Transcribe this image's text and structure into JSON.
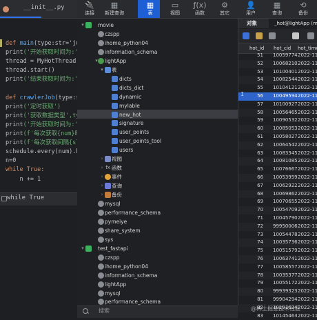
{
  "ide": {
    "tab_label": "__init__.py",
    "breadcrumb": "while True",
    "code_lines": [
      {
        "parts": [
          [
            "def ",
            "#cf8e6d"
          ],
          [
            "main",
            "#56a8f5"
          ],
          [
            "(type:str='juejin'",
            "#bcbec4"
          ]
        ]
      },
      {
        "parts": [
          [
            "print",
            "#bcbec4"
          ],
          [
            "('开始获取时间为:',",
            "#6aab73"
          ]
        ]
      },
      {
        "parts": [
          [
            "thread = MyHotThread(t",
            "#bcbec4"
          ]
        ]
      },
      {
        "parts": [
          [
            "thread.start()",
            "#bcbec4"
          ]
        ]
      },
      {
        "parts": [
          [
            "print",
            "#bcbec4"
          ],
          [
            "('结束获取时间为:',",
            "#6aab73"
          ]
        ]
      },
      {
        "parts": [
          [
            "",
            "#bcbec4"
          ]
        ]
      },
      {
        "parts": [
          [
            "def ",
            "#cf8e6d"
          ],
          [
            "crawlerJob",
            "#56a8f5"
          ],
          [
            "(type:str='j",
            "#bcbec4"
          ]
        ]
      },
      {
        "parts": [
          [
            "print",
            "#bcbec4"
          ],
          [
            "('定时获取')",
            "#6aab73"
          ]
        ]
      },
      {
        "parts": [
          [
            "print",
            "#bcbec4"
          ],
          [
            "('获取数据类型',typ",
            "#6aab73"
          ]
        ]
      },
      {
        "parts": [
          [
            "print",
            "#bcbec4"
          ],
          [
            "('开始获取时间为:',",
            "#6aab73"
          ]
        ]
      },
      {
        "parts": [
          [
            "print",
            "#bcbec4"
          ],
          [
            "(f'每次获取{num}时间",
            "#6aab73"
          ]
        ]
      },
      {
        "parts": [
          [
            "print",
            "#bcbec4"
          ],
          [
            "(f'每次获取间隔{sl}",
            "#6aab73"
          ]
        ]
      },
      {
        "parts": [
          [
            "schedule.every(num).ho",
            "#bcbec4"
          ]
        ]
      },
      {
        "parts": [
          [
            "n=0",
            "#bcbec4"
          ]
        ]
      },
      {
        "parts": [
          [
            "while ",
            "#cf8e6d"
          ],
          [
            "True:",
            "#cf8e6d"
          ]
        ]
      },
      {
        "parts": [
          [
            "    n += 1",
            "#bcbec4"
          ]
        ]
      }
    ]
  },
  "toolbar": {
    "items": [
      {
        "label": "连接",
        "icon": "🔌"
      },
      {
        "label": "新建查询",
        "icon": "▦"
      },
      {
        "label": "表",
        "icon": "▦"
      },
      {
        "label": "视图",
        "icon": "▭"
      },
      {
        "label": "函数",
        "icon": "ƒ(x)"
      },
      {
        "label": "其它",
        "icon": "⚙"
      },
      {
        "label": "用户",
        "icon": "👤"
      },
      {
        "label": "查询",
        "icon": "▦"
      },
      {
        "label": "备份",
        "icon": "⟲"
      }
    ]
  },
  "tree": {
    "items": [
      {
        "text": "movie",
        "indent": 0,
        "arrow": "▾",
        "icon": "conn"
      },
      {
        "text": "czspp",
        "indent": 1,
        "arrow": "",
        "icon": "db"
      },
      {
        "text": "ihome_python04",
        "indent": 1,
        "arrow": "",
        "icon": "db"
      },
      {
        "text": "information_schema",
        "indent": 1,
        "arrow": "",
        "icon": "db"
      },
      {
        "text": "lightApp",
        "indent": 1,
        "arrow": "▾",
        "icon": "db-open"
      },
      {
        "text": "表",
        "indent": 2,
        "arrow": "▾",
        "icon": "group"
      },
      {
        "text": "dicts",
        "indent": 3,
        "arrow": "",
        "icon": "tbl"
      },
      {
        "text": "dicts_dict",
        "indent": 3,
        "arrow": "",
        "icon": "tbl"
      },
      {
        "text": "dynamic",
        "indent": 3,
        "arrow": "",
        "icon": "tbl"
      },
      {
        "text": "mylable",
        "indent": 3,
        "arrow": "",
        "icon": "tbl"
      },
      {
        "text": "new_hot",
        "indent": 3,
        "arrow": "",
        "icon": "tbl"
      },
      {
        "text": "signature",
        "indent": 3,
        "arrow": "",
        "icon": "tbl"
      },
      {
        "text": "user_points",
        "indent": 3,
        "arrow": "",
        "icon": "tbl"
      },
      {
        "text": "user_points_tool",
        "indent": 3,
        "arrow": "",
        "icon": "tbl"
      },
      {
        "text": "users",
        "indent": 3,
        "arrow": "",
        "icon": "tbl"
      },
      {
        "text": "视图",
        "indent": 2,
        "arrow": "›",
        "icon": "view"
      },
      {
        "text": "函数",
        "indent": 2,
        "arrow": "›",
        "icon": "func"
      },
      {
        "text": "事件",
        "indent": 2,
        "arrow": "›",
        "icon": "event"
      },
      {
        "text": "查询",
        "indent": 2,
        "arrow": "›",
        "icon": "query"
      },
      {
        "text": "备份",
        "indent": 2,
        "arrow": "›",
        "icon": "backup"
      },
      {
        "text": "mysql",
        "indent": 1,
        "arrow": "",
        "icon": "db"
      },
      {
        "text": "performance_schema",
        "indent": 1,
        "arrow": "",
        "icon": "db"
      },
      {
        "text": "pymeiye",
        "indent": 1,
        "arrow": "",
        "icon": "db"
      },
      {
        "text": "share_system",
        "indent": 1,
        "arrow": "",
        "icon": "db"
      },
      {
        "text": "sys",
        "indent": 1,
        "arrow": "",
        "icon": "db"
      },
      {
        "text": "test_fastapi",
        "indent": 0,
        "arrow": "▾",
        "icon": "conn"
      },
      {
        "text": "czspp",
        "indent": 1,
        "arrow": "",
        "icon": "db"
      },
      {
        "text": "ihome_python04",
        "indent": 1,
        "arrow": "",
        "icon": "db"
      },
      {
        "text": "information_schema",
        "indent": 1,
        "arrow": "",
        "icon": "db"
      },
      {
        "text": "lightApp",
        "indent": 1,
        "arrow": "",
        "icon": "db"
      },
      {
        "text": "mysql",
        "indent": 1,
        "arrow": "",
        "icon": "db"
      },
      {
        "text": "performance_schema",
        "indent": 1,
        "arrow": "",
        "icon": "db"
      }
    ],
    "selected_index": 10,
    "search_placeholder": "搜索"
  },
  "grid": {
    "tab_objects": "对象",
    "tab_active": "_hot@lightApp (m",
    "columns": [
      "hot_id",
      "hot_cid",
      "hot_time"
    ],
    "rows": [
      [
        "51",
        "10059774",
        "2022-11-"
      ],
      [
        "52",
        "10068210",
        "2022-11-"
      ],
      [
        "53",
        "10100401",
        "2022-11-"
      ],
      [
        "54",
        "10082544",
        "2022-11-"
      ],
      [
        "55",
        "10104121",
        "2022-11-"
      ],
      [
        "56",
        "10049594",
        "2022-11-"
      ],
      [
        "57",
        "10100927",
        "2022-11-"
      ],
      [
        "58",
        "10056465",
        "2022-11-"
      ],
      [
        "59",
        "10090532",
        "2022-11-"
      ],
      [
        "60",
        "10085053",
        "2022-11-"
      ],
      [
        "61",
        "10058027",
        "2022-11-"
      ],
      [
        "62",
        "10064542",
        "2022-11-"
      ],
      [
        "63",
        "10083345",
        "2022-11-"
      ],
      [
        "64",
        "10081085",
        "2022-11-"
      ],
      [
        "65",
        "10076667",
        "2022-11-"
      ],
      [
        "66",
        "10053959",
        "2022-11-"
      ],
      [
        "67",
        "10062922",
        "2022-11-"
      ],
      [
        "68",
        "10069862",
        "2022-11-"
      ],
      [
        "69",
        "10070655",
        "2022-11-"
      ],
      [
        "70",
        "10054709",
        "2022-11-"
      ],
      [
        "71",
        "10045790",
        "2022-11-"
      ],
      [
        "72",
        "99950006",
        "2022-11-"
      ],
      [
        "73",
        "10054478",
        "2022-11-"
      ],
      [
        "74",
        "10035736",
        "2022-11-"
      ],
      [
        "75",
        "10051579",
        "2022-11-"
      ],
      [
        "76",
        "10063741",
        "2022-11-"
      ],
      [
        "77",
        "10058557",
        "2022-11-"
      ],
      [
        "78",
        "10035377",
        "2022-11-"
      ],
      [
        "79",
        "10055172",
        "2022-11-"
      ],
      [
        "80",
        "99939323",
        "2022-11-"
      ],
      [
        "81",
        "99904294",
        "2022-11-"
      ],
      [
        "82",
        "10191624",
        "2022-11-"
      ],
      [
        "83",
        "10145463",
        "2022-11-"
      ]
    ],
    "selected_row": 5,
    "cursor_glyph": "I",
    "watermark": "@稀土掘金技术社区"
  }
}
